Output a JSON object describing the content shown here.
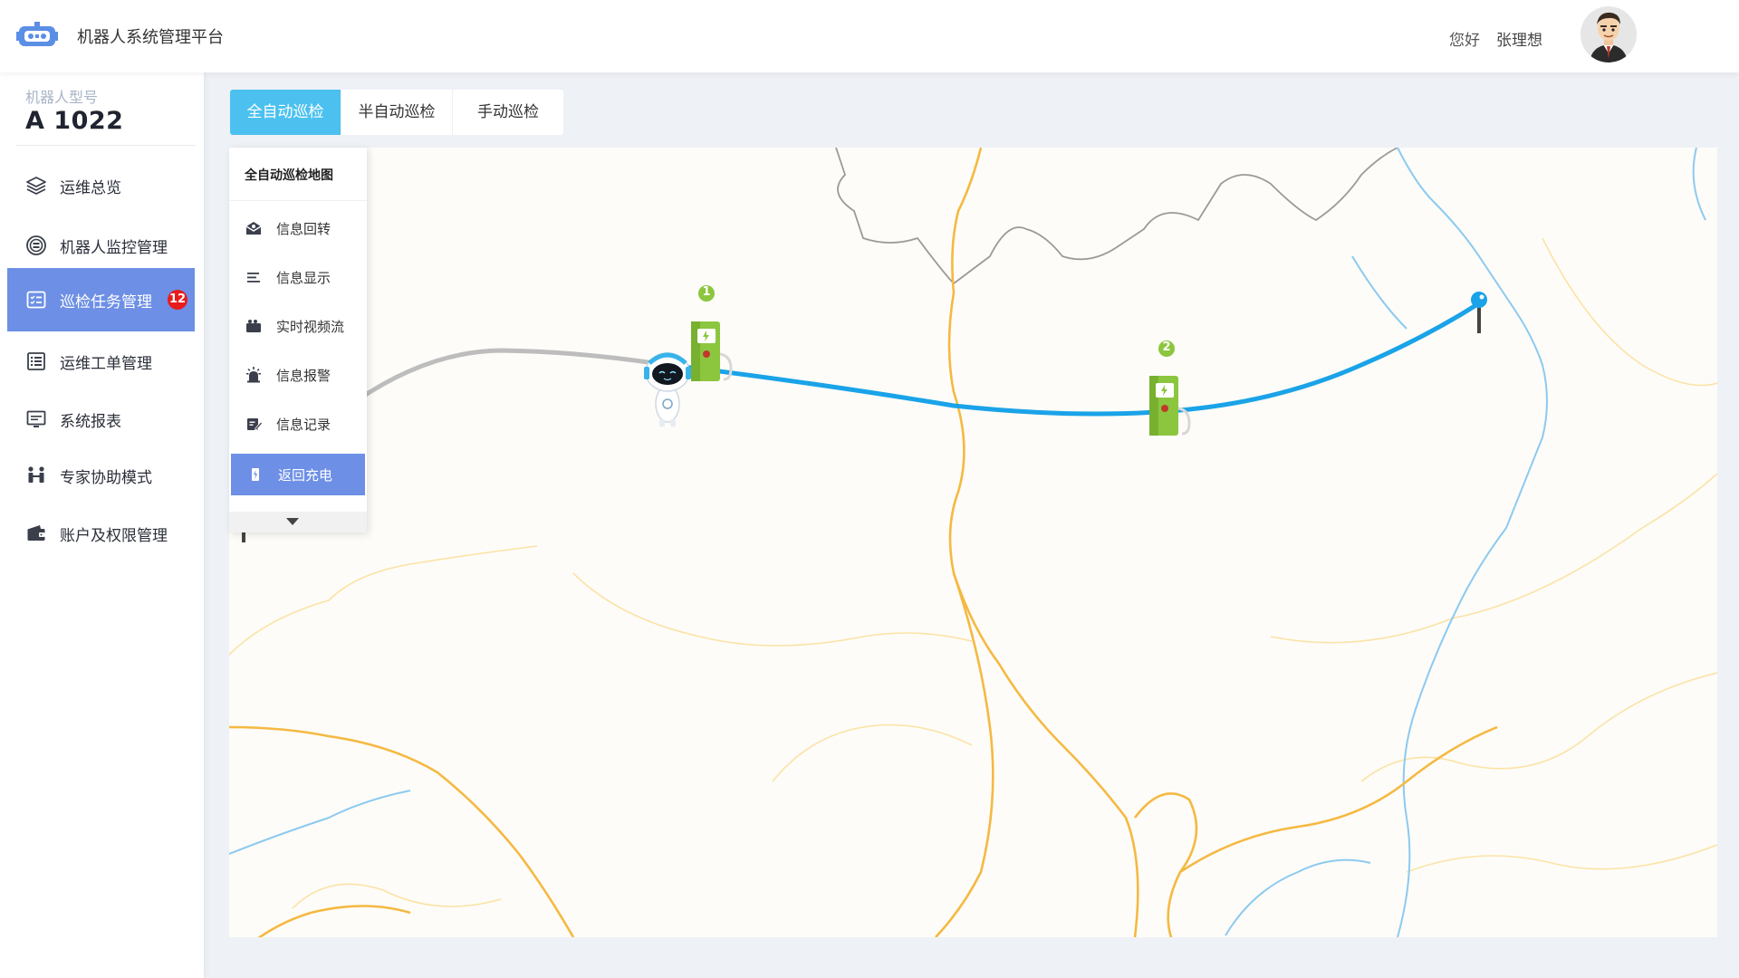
{
  "header": {
    "app_title": "机器人系统管理平台",
    "greeting": "您好",
    "user_name": "张理想",
    "logo_icon": "robot-logo-icon",
    "avatar_icon": "user-avatar"
  },
  "sidebar": {
    "model_caption": "机器人型号",
    "model_value": "A 1022",
    "items": [
      {
        "label": "运维总览",
        "icon": "layers-icon"
      },
      {
        "label": "机器人监控管理",
        "icon": "monitor-circle-icon"
      },
      {
        "label": "巡检任务管理",
        "icon": "task-list-icon",
        "badge": "12",
        "active": true
      },
      {
        "label": "运维工单管理",
        "icon": "work-order-icon"
      },
      {
        "label": "系统报表",
        "icon": "report-screen-icon"
      },
      {
        "label": "专家协助模式",
        "icon": "expert-assist-icon"
      },
      {
        "label": "账户及权限管理",
        "icon": "wallet-icon"
      }
    ]
  },
  "tabs": [
    {
      "label": "全自动巡检",
      "active": true
    },
    {
      "label": "半自动巡检",
      "active": false
    },
    {
      "label": "手动巡检",
      "active": false
    }
  ],
  "map_menu": {
    "title": "全自动巡检地图",
    "items": [
      {
        "label": "信息回转",
        "icon": "envelope-open-icon"
      },
      {
        "label": "信息显示",
        "icon": "lines-icon"
      },
      {
        "label": "实时视频流",
        "icon": "video-camera-icon"
      },
      {
        "label": "信息报警",
        "icon": "alarm-light-icon"
      },
      {
        "label": "信息记录",
        "icon": "note-edit-icon"
      },
      {
        "label": "返回充电",
        "icon": "charging-icon",
        "active": true
      }
    ],
    "expand_icon": "caret-down-icon"
  },
  "map": {
    "stations": [
      {
        "label": "1",
        "icon": "charging-station-icon"
      },
      {
        "label": "2",
        "icon": "charging-station-icon"
      }
    ],
    "start_marker_icon": "red-pin-icon",
    "end_marker_icon": "blue-pin-icon",
    "robot_icon": "robot-icon",
    "colors": {
      "traveled_route": "#bdbdbd",
      "planned_route": "#1aa3e8",
      "road_major": "#f5b942",
      "road_minor": "#fbe3a6",
      "river": "#8ccaf0",
      "border": "#9a9a9a"
    }
  },
  "colors": {
    "accent": "#6d8fe5",
    "tab_active": "#4cc1ef",
    "badge": "#e81c1c"
  }
}
